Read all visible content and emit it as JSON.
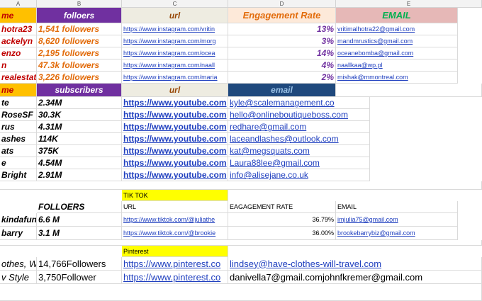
{
  "columns": [
    "A",
    "B",
    "C",
    "D",
    "E"
  ],
  "instagram": {
    "headers": {
      "name": "me",
      "followers": "folloers",
      "url": "url",
      "rate": "Engagement Rate",
      "email": "EMAIL"
    },
    "rows": [
      {
        "name": "hotra23",
        "followers": "1,541 followers",
        "url": "https://www.instagram.com/vritin",
        "rate": "13%",
        "email": "vritimalhotra22@gmail.com"
      },
      {
        "name": "ackelyn",
        "followers": "8,620 followers",
        "url": "https://www.instagram.com/morg",
        "rate": "3%",
        "email": "mandmrustics@gmail.com"
      },
      {
        "name": "enzo",
        "followers": "2,195 followers",
        "url": "https://www.instagram.com/ocea",
        "rate": "14%",
        "email": "oceanebomba@gmail.com"
      },
      {
        "name": "n",
        "followers": "47.3k followers",
        "url": "https://www.instagram.com/naall",
        "rate": "4%",
        "email": "naallkaa@wp.pl"
      },
      {
        "name": "realestate",
        "followers": "3,226 followers",
        "url": "https://www.instagram.com/maria",
        "rate": "2%",
        "email": "mishak@mmontreal.com"
      }
    ]
  },
  "youtube": {
    "headers": {
      "name": "me",
      "subscribers": "subscribers",
      "url": "url",
      "email": "email"
    },
    "rows": [
      {
        "name": "te",
        "subscribers": "2.34M",
        "url": "https://www.youtube.com",
        "email": "kyle@scalemanagement.co"
      },
      {
        "name": "RoseSF",
        "subscribers": "30.3K",
        "url": "https://www.youtube.com",
        "email": "hello@onlineboutiqueboss.com"
      },
      {
        "name": "rus",
        "subscribers": "4.31M",
        "url": "https://www.youtube.com",
        "email": "redhare@gmail.com"
      },
      {
        "name": "ashes",
        "subscribers": "114K",
        "url": "https://www.youtube.com",
        "email": "laceandlashes@outlook.com"
      },
      {
        "name": "ats",
        "subscribers": "375K",
        "url": "https://www.youtube.com",
        "email": "kat@megsquats.com"
      },
      {
        "name": "e",
        "subscribers": "4.54M",
        "url": "https://www.youtube.com",
        "email": "Laura88lee@gmail.com"
      },
      {
        "name": "Bright",
        "subscribers": "2.91M",
        "url": "https://www.youtube.com",
        "email": "info@alisejane.co.uk"
      }
    ]
  },
  "tiktok": {
    "label": "TIK TOK",
    "headers": {
      "followers": "FOLLOERS",
      "url": "URL",
      "rate": "EAGAGEMENT RATE",
      "email": "EMAIL"
    },
    "rows": [
      {
        "name": "kindafunn",
        "followers": "6.6 M",
        "url": "https://www.tiktok.com/@juliathe",
        "rate": "36.79%",
        "email": "imjulia75@gmail.com"
      },
      {
        "name": "barry",
        "followers": "3.1 M",
        "url": "https://www.tiktok.com/@brookie",
        "rate": "36.00%",
        "email": "brookebarrybiz@gmail.com"
      }
    ]
  },
  "pinterest": {
    "label": "Pinterest",
    "rows": [
      {
        "name": "othes, W",
        "followers": "14,766Followers",
        "url": "https://www.pinterest.co",
        "email": "lindsey@have-clothes-will-travel.com"
      },
      {
        "name": "v Style",
        "followers": "3,750Follower",
        "url": "https://www.pinterest.co",
        "email": "danivella7@gmail.comjohnfkremer@gmail.com"
      }
    ]
  }
}
